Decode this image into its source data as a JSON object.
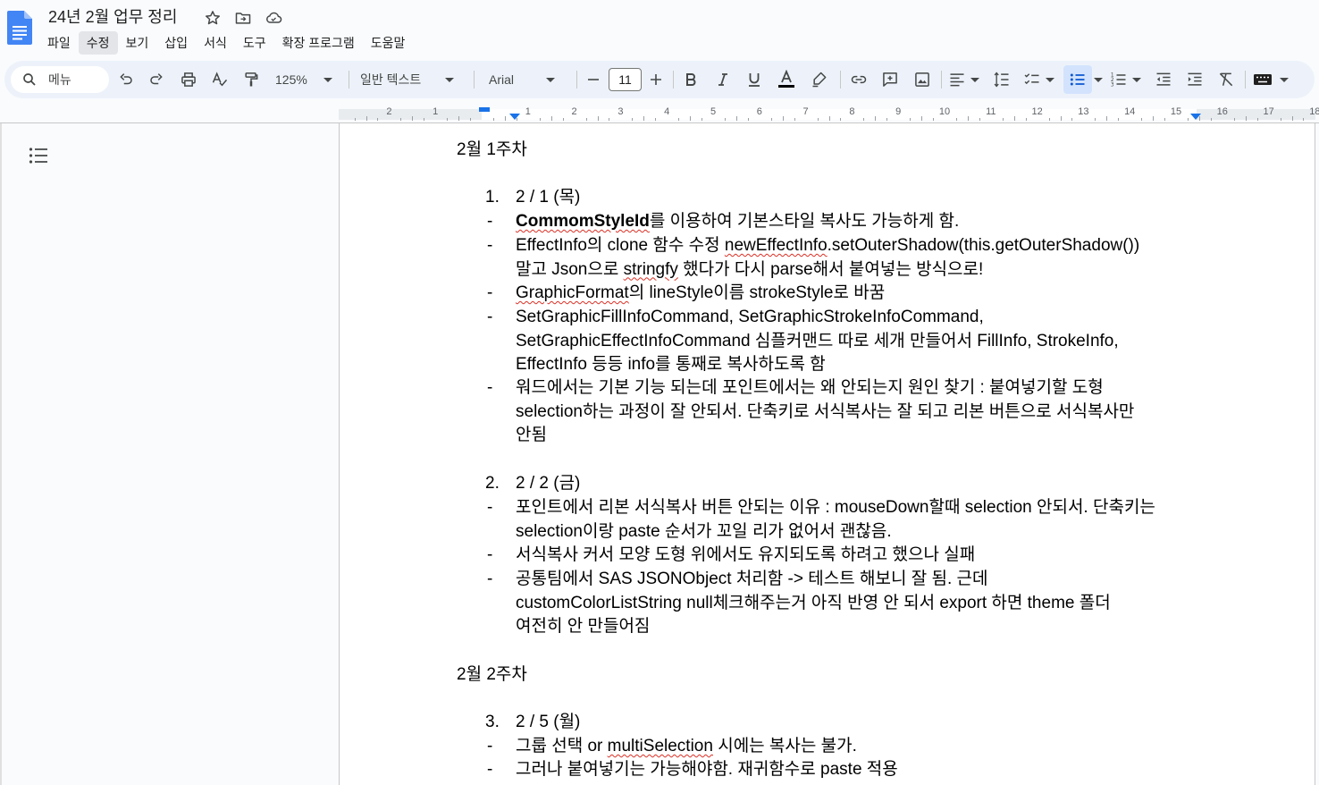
{
  "app": {
    "doc_title": "24년 2월 업무 정리",
    "menu": [
      {
        "label": "파일",
        "name": "menu-file"
      },
      {
        "label": "수정",
        "name": "menu-edit"
      },
      {
        "label": "보기",
        "name": "menu-view"
      },
      {
        "label": "삽입",
        "name": "menu-insert"
      },
      {
        "label": "서식",
        "name": "menu-format"
      },
      {
        "label": "도구",
        "name": "menu-tools"
      },
      {
        "label": "확장 프로그램",
        "name": "menu-extensions"
      },
      {
        "label": "도움말",
        "name": "menu-help"
      }
    ],
    "active_menu": "수정"
  },
  "toolbar": {
    "search_menu_label": "메뉴",
    "zoom": "125%",
    "style": "일반 텍스트",
    "font": "Arial",
    "font_size": "11"
  },
  "ruler": {
    "numbers": [
      "2",
      "1",
      "1",
      "2",
      "3",
      "4",
      "5",
      "6",
      "7",
      "8",
      "9",
      "10",
      "11",
      "12",
      "13",
      "14",
      "15",
      "16",
      "17",
      "18"
    ]
  },
  "document": {
    "week1_heading": "2월 1주차",
    "item1_num": "1.",
    "item1_label": "2 / 1 (목)",
    "b1_1_bold": "CommomStyleId",
    "b1_1_rest": "를 이용하여 기본스타일 복사도 가능하게 함.",
    "b1_2_a": "EffectInfo의 clone 함수 수정 ",
    "b1_2_sq": "newEffectInfo",
    "b1_2_b": ".setOuterShadow(this.getOuterShadow())",
    "b1_2_c": "말고 Json으로 ",
    "b1_2_sq2": "stringfy",
    "b1_2_d": " 했다가 다시 parse해서 붙여넣는 방식으로!",
    "b1_3_sq": "GraphicFormat",
    "b1_3_rest": "의 lineStyle이름 strokeStyle로 바꿈",
    "b1_4_l1": "SetGraphicFillInfoCommand, SetGraphicStrokeInfoCommand,",
    "b1_4_l2": "SetGraphicEffectInfoCommand 심플커맨드 따로 세개 만들어서 FillInfo, StrokeInfo,",
    "b1_4_l3": "EffectInfo 등등 info를 통째로 복사하도록 함",
    "b1_5_l1": "워드에서는 기본 기능 되는데 포인트에서는 왜 안되는지 원인 찾기 : 붙여넣기할 도형",
    "b1_5_l2": "selection하는 과정이 잘 안되서. 단축키로 서식복사는 잘 되고 리본 버튼으로 서식복사만",
    "b1_5_l3": "안됨",
    "item2_num": "2.",
    "item2_label": "2 / 2 (금)",
    "b2_1_l1": "포인트에서 리본 서식복사 버튼 안되는 이유 : mouseDown할때 selection 안되서. 단축키는",
    "b2_1_l2": "selection이랑 paste 순서가 꼬일 리가 없어서 괜찮음.",
    "b2_2": "서식복사 커서 모양 도형 위에서도 유지되도록 하려고 했으나 실패",
    "b2_3_l1": "공통팀에서 SAS JSONObject 처리함 -> 테스트 해보니 잘 됨. 근데",
    "b2_3_l2": "customColorListString null체크해주는거 아직 반영 안 되서 export 하면 theme 폴더",
    "b2_3_l3": "여전히 안 만들어짐",
    "week2_heading": "2월 2주차",
    "item3_num": "3.",
    "item3_label": "2 / 5 (월)",
    "b3_1_a": "그룹 선택 or ",
    "b3_1_sq": "multiSelection",
    "b3_1_b": " 시에는 복사는 불가.",
    "b3_2": "그러나 붙여넣기는 가능해야함. 재귀함수로 paste 적용",
    "bullet_char": "-"
  },
  "colors": {
    "accent": "#1a73e8",
    "toolbar_bg": "#edf2fa",
    "spell_underline": "#d93025",
    "doc_icon": "#4285f4"
  }
}
